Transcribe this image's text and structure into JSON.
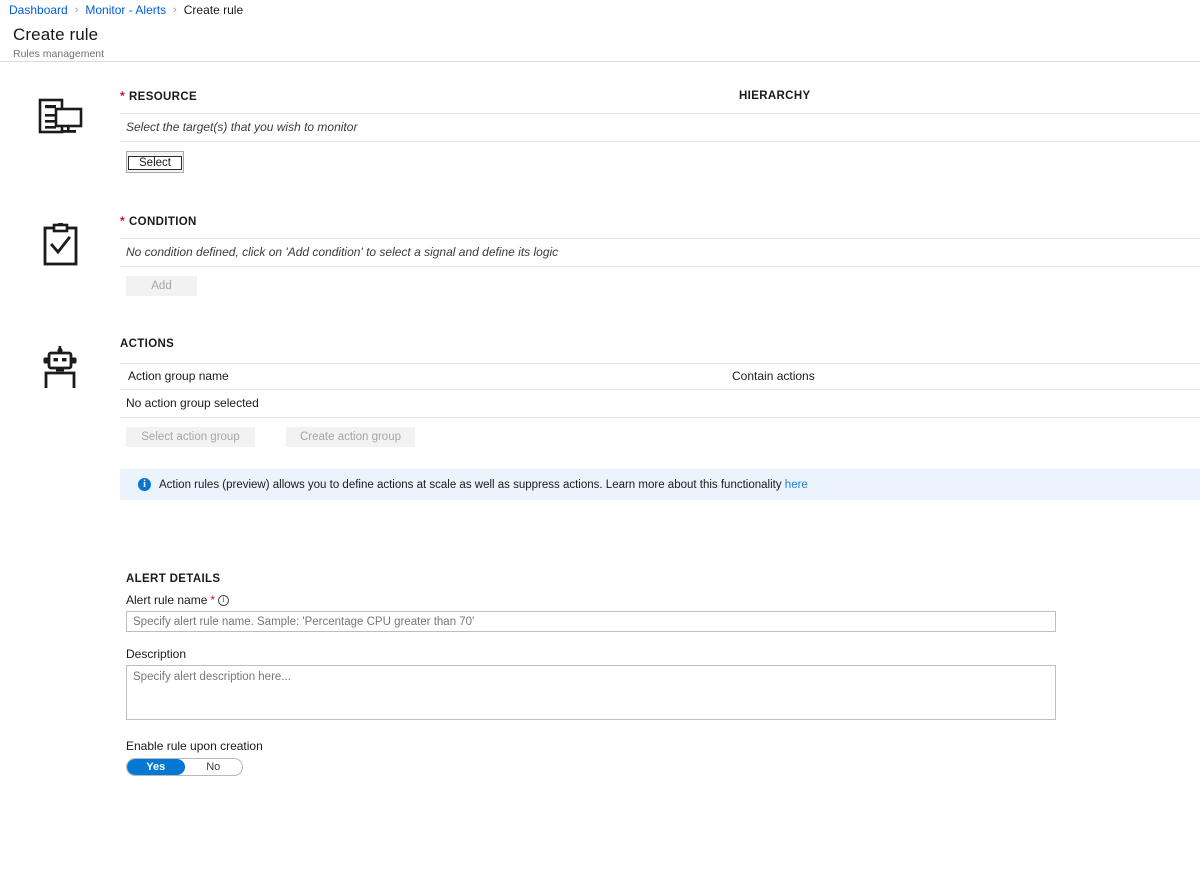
{
  "breadcrumb": {
    "items": [
      {
        "label": "Dashboard",
        "link": true
      },
      {
        "label": "Monitor - Alerts",
        "link": true
      },
      {
        "label": "Create rule",
        "link": false
      }
    ],
    "separator": "›"
  },
  "header": {
    "title": "Create rule",
    "subtitle": "Rules management"
  },
  "resource": {
    "icon": "server-monitor-icon",
    "heading": "RESOURCE",
    "required": true,
    "required_marker": "*",
    "hierarchy_heading": "HIERARCHY",
    "placeholder_text": "Select the target(s) that you wish to monitor",
    "select_button": "Select"
  },
  "condition": {
    "icon": "clipboard-check-icon",
    "heading": "CONDITION",
    "required": true,
    "required_marker": "*",
    "placeholder_text": "No condition defined, click on 'Add condition' to select a signal and define its logic",
    "add_button": "Add",
    "add_button_disabled": true
  },
  "actions": {
    "icon": "robot-icon",
    "heading": "ACTIONS",
    "columns": [
      "Action group name",
      "Contain actions"
    ],
    "empty_row": "No action group selected",
    "select_button": "Select action group",
    "create_button": "Create action group",
    "buttons_disabled": true,
    "banner": {
      "icon": "info-icon",
      "text": "Action rules (preview) allows you to define actions at scale as well as suppress actions. Learn more about this functionality ",
      "link_text": "here",
      "background": "#ebf3fc"
    }
  },
  "alert_details": {
    "heading": "ALERT DETAILS",
    "rule_name": {
      "label": "Alert rule name",
      "required_marker": "*",
      "info_icon": "info-circle-icon",
      "value": "",
      "placeholder": "Specify alert rule name. Sample: 'Percentage CPU greater than 70'"
    },
    "description": {
      "label": "Description",
      "value": "",
      "placeholder": "Specify alert description here..."
    },
    "enable_rule": {
      "label": "Enable rule upon creation",
      "options": [
        "Yes",
        "No"
      ],
      "selected": "Yes",
      "accent_color": "#0078d4"
    }
  }
}
